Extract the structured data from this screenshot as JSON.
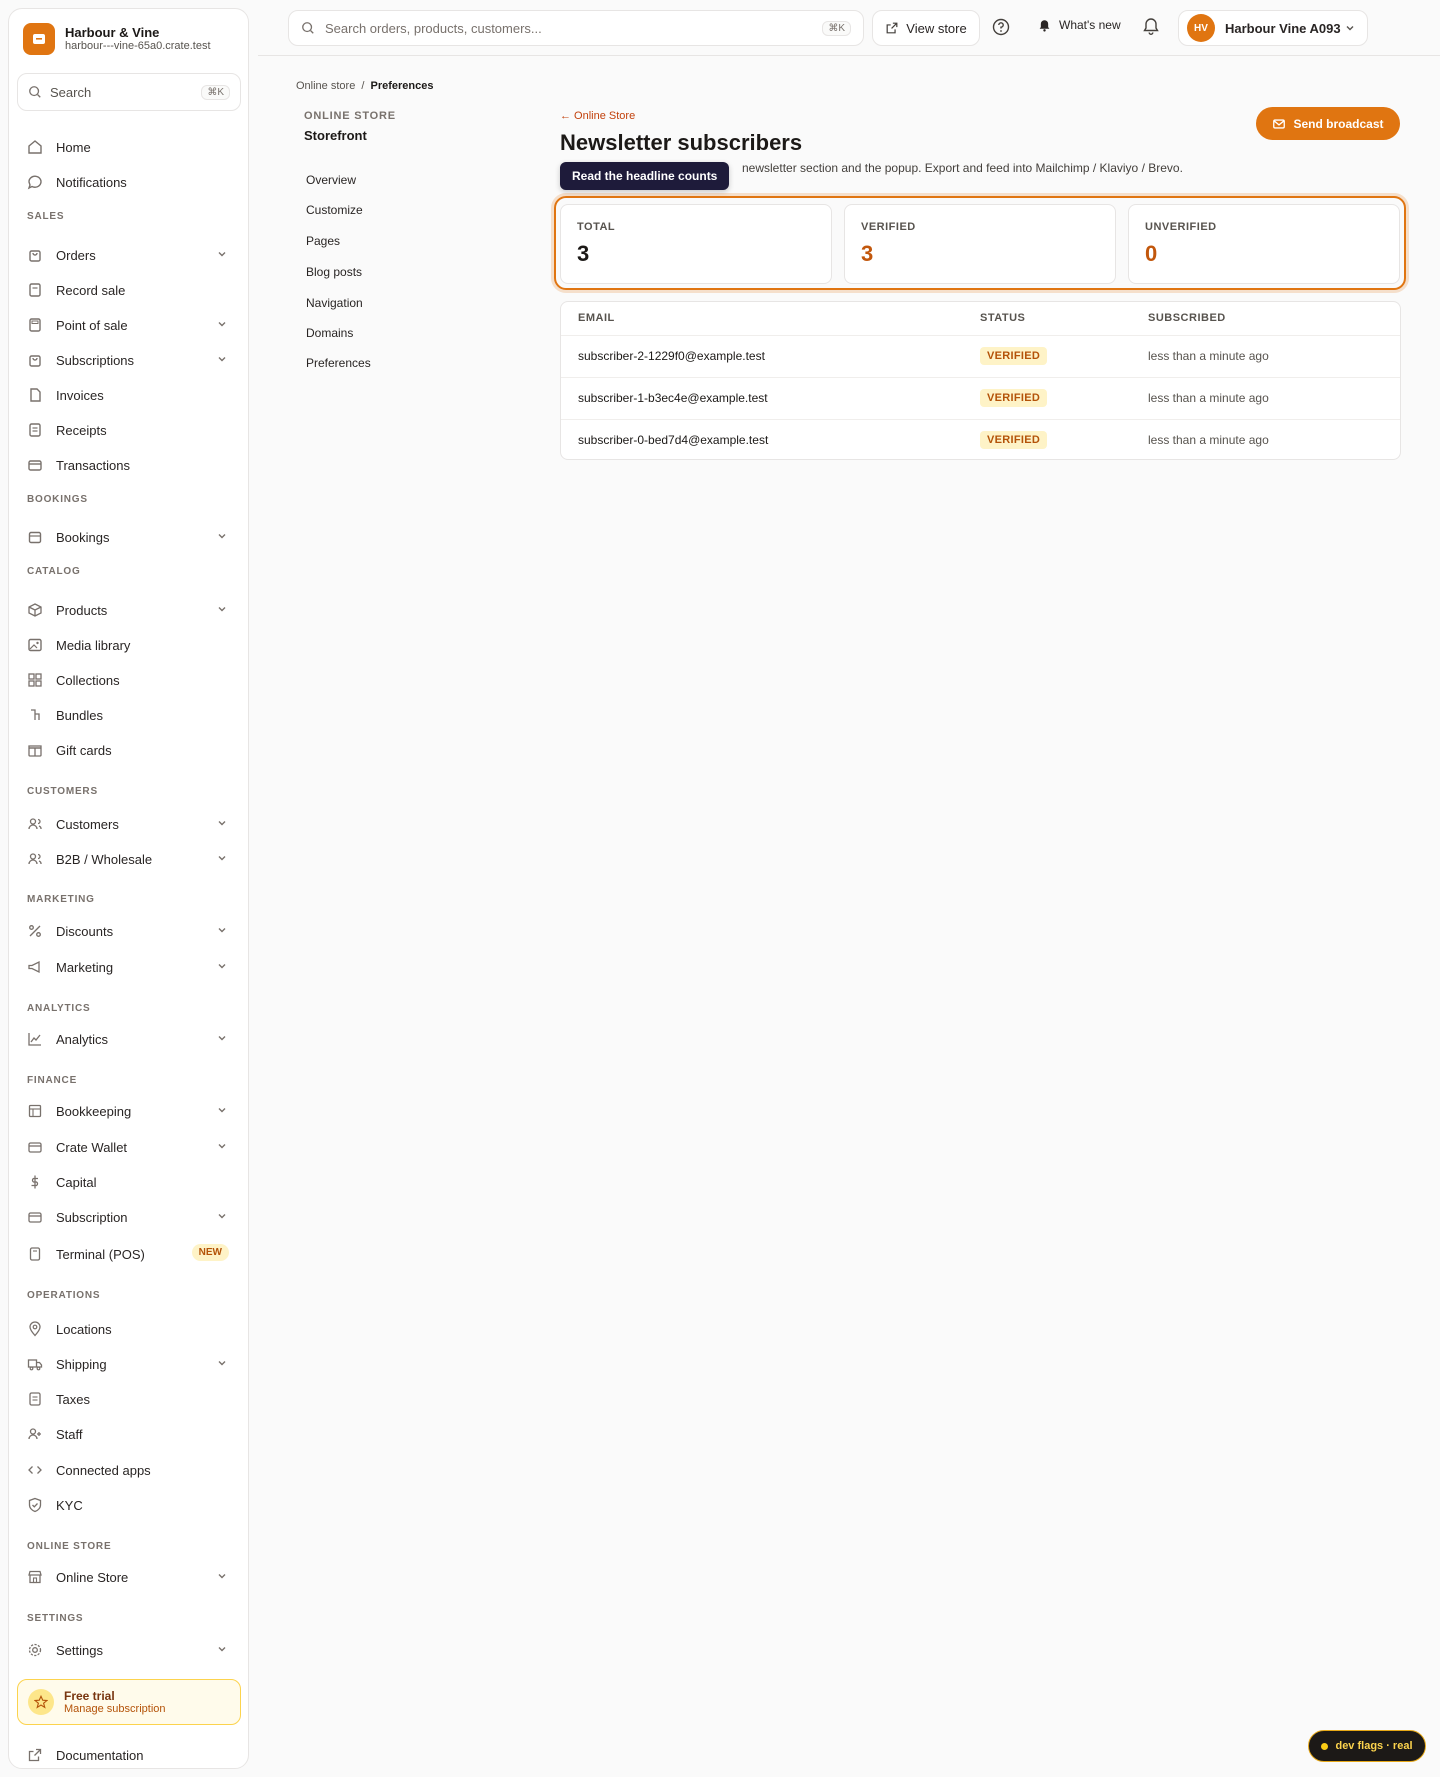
{
  "brand": {
    "name": "Harbour & Vine",
    "host": "harbour---vine-65a0.crate.test"
  },
  "sidebar": {
    "search_label": "Search",
    "search_kbd": "⌘K",
    "top_items": [
      {
        "label": "Home"
      },
      {
        "label": "Notifications"
      }
    ],
    "sections": {
      "sales": "SALES",
      "bookings": "BOOKINGS",
      "catalog": "CATALOG",
      "customers": "CUSTOMERS",
      "marketing": "MARKETING",
      "analytics": "ANALYTICS",
      "finance": "FINANCE",
      "operations": "OPERATIONS",
      "online_store": "ONLINE STORE",
      "settings": "SETTINGS"
    },
    "items": {
      "orders": "Orders",
      "record_sale": "Record sale",
      "point_of_sale": "Point of sale",
      "subscriptions": "Subscriptions",
      "invoices": "Invoices",
      "receipts": "Receipts",
      "transactions": "Transactions",
      "bookings": "Bookings",
      "products": "Products",
      "media_library": "Media library",
      "collections": "Collections",
      "bundles": "Bundles",
      "gift_cards": "Gift cards",
      "customers": "Customers",
      "b2b": "B2B / Wholesale",
      "discounts": "Discounts",
      "marketing": "Marketing",
      "analytics": "Analytics",
      "bookkeeping": "Bookkeeping",
      "crate_wallet": "Crate Wallet",
      "capital": "Capital",
      "subscription": "Subscription",
      "terminal": "Terminal (POS)",
      "terminal_badge": "NEW",
      "locations": "Locations",
      "shipping": "Shipping",
      "taxes": "Taxes",
      "staff": "Staff",
      "connected_apps": "Connected apps",
      "kyc": "KYC",
      "online_store": "Online Store",
      "settings": "Settings"
    },
    "trial": {
      "title": "Free trial",
      "subtitle": "Manage subscription"
    },
    "documentation": "Documentation"
  },
  "topbar": {
    "search_placeholder": "Search orders, products, customers...",
    "search_kbd": "⌘K",
    "view_store": "View store",
    "whats_new": "What's new",
    "account_initials": "HV",
    "account_name": "Harbour Vine A093"
  },
  "breadcrumb": {
    "parent": "Online store",
    "separator": "/",
    "current": "Preferences"
  },
  "subnav": {
    "heading": "ONLINE STORE",
    "title": "Storefront",
    "items": [
      "Overview",
      "Customize",
      "Pages",
      "Blog posts",
      "Navigation",
      "Domains",
      "Preferences"
    ]
  },
  "main": {
    "back_link": "← Online Store",
    "title": "Newsletter subscribers",
    "description": "newsletter section and the popup. Export and feed into Mailchimp / Klaviyo / Brevo.",
    "tooltip": "Read the headline counts",
    "broadcast_button": "Send broadcast",
    "stats": [
      {
        "label": "TOTAL",
        "value": "3",
        "color": "#1c1917"
      },
      {
        "label": "VERIFIED",
        "value": "3",
        "color": "#c2570c"
      },
      {
        "label": "UNVERIFIED",
        "value": "0",
        "color": "#c2570c"
      }
    ],
    "table": {
      "headers": {
        "email": "EMAIL",
        "status": "STATUS",
        "subscribed": "SUBSCRIBED"
      },
      "rows": [
        {
          "email": "subscriber-2-1229f0@example.test",
          "status": "VERIFIED",
          "subscribed": "less than a minute ago"
        },
        {
          "email": "subscriber-1-b3ec4e@example.test",
          "status": "VERIFIED",
          "subscribed": "less than a minute ago"
        },
        {
          "email": "subscriber-0-bed7d4@example.test",
          "status": "VERIFIED",
          "subscribed": "less than a minute ago"
        }
      ]
    }
  },
  "dev_flags": "dev flags · real",
  "colors": {
    "accent": "#e07511",
    "accent_text": "#c2570c",
    "badge_bg": "#fef3c7"
  }
}
